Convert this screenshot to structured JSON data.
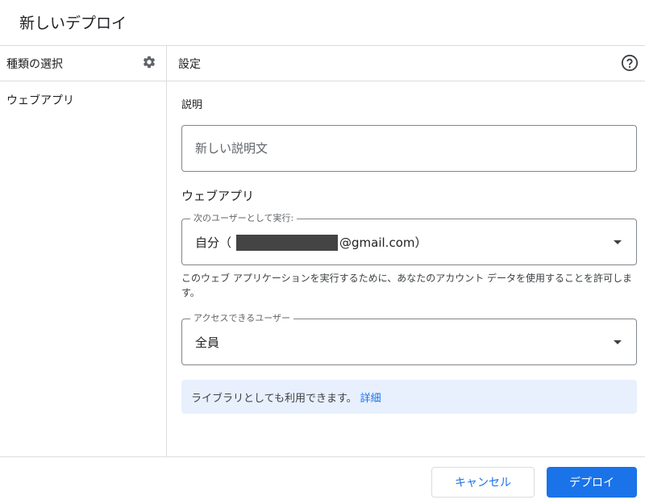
{
  "dialog": {
    "title": "新しいデプロイ"
  },
  "left_panel": {
    "header": "種類の選択",
    "gear_icon": "gear-icon",
    "items": [
      {
        "label": "ウェブアプリ"
      }
    ]
  },
  "right_panel": {
    "header": "設定",
    "help_icon": "help-circle-icon",
    "description": {
      "label": "説明",
      "placeholder": "新しい説明文",
      "value": ""
    },
    "webapp_section": {
      "title": "ウェブアプリ",
      "execute_as": {
        "legend": "次のユーザーとして実行:",
        "value_prefix": "自分（",
        "value_suffix": "@gmail.com）",
        "helper": "このウェブ アプリケーションを実行するために、あなたのアカウント データを使用することを許可します。"
      },
      "access": {
        "legend": "アクセスできるユーザー",
        "value": "全員"
      }
    },
    "info_banner": {
      "text": "ライブラリとしても利用できます。",
      "link": "詳細"
    }
  },
  "footer": {
    "cancel_label": "キャンセル",
    "deploy_label": "デプロイ"
  },
  "colors": {
    "accent": "#1a73e8",
    "banner_bg": "#e8f0fe",
    "divider": "#dadce0"
  }
}
